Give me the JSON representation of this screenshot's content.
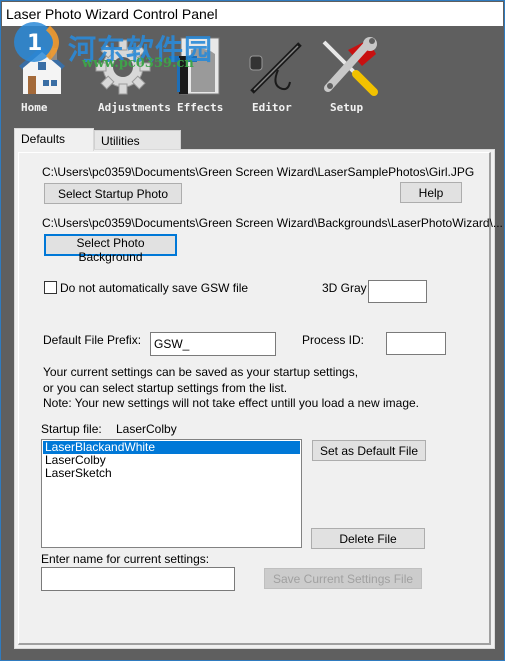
{
  "window": {
    "title": "Laser Photo Wizard Control Panel"
  },
  "watermark": {
    "text_cn": "河东软件园",
    "url": "www.pc0359.cn"
  },
  "toolbar": {
    "items": [
      {
        "label": "Home",
        "icon": "house-icon"
      },
      {
        "label": "Adjustments",
        "icon": "gear-icon"
      },
      {
        "label": "Effects",
        "icon": "effects-book-icon"
      },
      {
        "label": "Editor",
        "icon": "airbrush-icon"
      },
      {
        "label": "Setup",
        "icon": "wrench-screwdriver-icon"
      }
    ]
  },
  "tabs": [
    {
      "label": "Defaults",
      "active": true
    },
    {
      "label": "Utilities",
      "active": false
    }
  ],
  "defaults": {
    "startup_photo_path": "C:\\Users\\pc0359\\Documents\\Green Screen Wizard\\LaserSamplePhotos\\Girl.JPG",
    "select_startup_photo_label": "Select Startup Photo",
    "help_label": "Help",
    "background_path": "C:\\Users\\pc0359\\Documents\\Green Screen Wizard\\Backgrounds\\LaserPhotoWizard\\...",
    "select_photo_background_label": "Select Photo Background",
    "no_autosave_label": "Do not automatically save GSW file",
    "no_autosave_checked": false,
    "gray3d_label": "3D Gray",
    "gray3d_value": "",
    "file_prefix_label": "Default File Prefix:",
    "file_prefix_value": "GSW_",
    "process_id_label": "Process ID:",
    "process_id_value": "",
    "info_line1": "Your current settings can be saved as your startup settings,",
    "info_line2": "or you can select startup settings from the list.",
    "info_line3": "Note:  Your new settings will not take effect untill you load a new image.",
    "startup_file_label": "Startup file:",
    "startup_file_value": "LaserColby",
    "settings_files": [
      {
        "name": "LaserBlackandWhite",
        "selected": true
      },
      {
        "name": "LaserColby",
        "selected": false
      },
      {
        "name": "LaserSketch",
        "selected": false
      }
    ],
    "set_default_label": "Set as Default File",
    "delete_file_label": "Delete File",
    "enter_name_label": "Enter name for current settings:",
    "settings_name_value": "",
    "save_settings_label": "Save Current Settings File"
  },
  "colors": {
    "accent": "#0078d7",
    "toolbar_bg": "#5f5f5f",
    "panel_bg": "#f0f0f0",
    "window_border": "#2f7bbf"
  }
}
